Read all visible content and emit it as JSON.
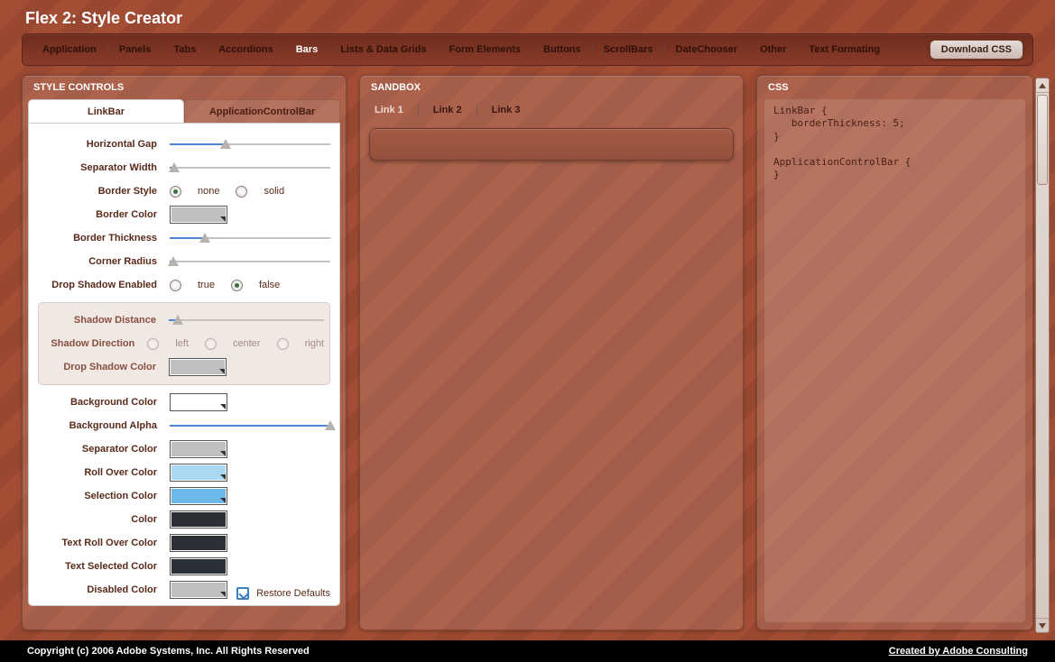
{
  "app_title": "Flex 2: Style Creator",
  "nav": {
    "items": [
      "Application",
      "Panels",
      "Tabs",
      "Accordions",
      "Bars",
      "Lists & Data Grids",
      "Form Elements",
      "Buttons",
      "ScrollBars",
      "DateChooser",
      "Other",
      "Text Formating"
    ],
    "active_index": 4,
    "download_label": "Download CSS"
  },
  "left": {
    "header": "STYLE CONTROLS",
    "subtabs": {
      "active": "LinkBar",
      "inactive": "ApplicationControlBar"
    },
    "rows": {
      "horizontal_gap": "Horizontal Gap",
      "separator_width": "Separator Width",
      "border_style": "Border Style",
      "border_style_opts": [
        "none",
        "solid"
      ],
      "border_color": "Border Color",
      "border_thickness": "Border Thickness",
      "corner_radius": "Corner Radius",
      "drop_shadow_enabled": "Drop Shadow Enabled",
      "shadow_enabled_opts": [
        "true",
        "false"
      ],
      "shadow_distance": "Shadow Distance",
      "shadow_direction": "Shadow Direction",
      "shadow_direction_opts": [
        "left",
        "center",
        "right"
      ],
      "drop_shadow_color": "Drop Shadow Color",
      "background_color": "Background Color",
      "background_alpha": "Background Alpha",
      "separator_color": "Separator Color",
      "roll_over_color": "Roll Over Color",
      "selection_color": "Selection Color",
      "color": "Color",
      "text_roll_over_color": "Text Roll Over Color",
      "text_selected_color": "Text Selected Color",
      "disabled_color": "Disabled Color"
    },
    "swatches": {
      "border_color": "#bfbfbf",
      "drop_shadow_color": "#bfbfbf",
      "background_color": "#ffffff",
      "separator_color": "#bfbfbf",
      "roll_over_color": "#a9d7f4",
      "selection_color": "#6db8ea",
      "color": "#2a3036",
      "text_roll_over_color": "#2a3036",
      "text_selected_color": "#2a3036",
      "disabled_color": "#bfbfbf"
    },
    "sliders": {
      "horizontal_gap_pct": 35,
      "separator_width_pct": 3,
      "border_thickness_pct": 22,
      "corner_radius_pct": 2,
      "shadow_distance_pct": 6,
      "background_alpha_pct": 100
    },
    "border_style_selected": "none",
    "shadow_enabled_selected": "false",
    "restore_label": "Restore Defaults"
  },
  "mid": {
    "header": "SANDBOX",
    "links": [
      "Link 1",
      "Link 2",
      "Link 3"
    ]
  },
  "right": {
    "header": "CSS",
    "code": "LinkBar {\n   borderThickness: 5;\n}\n\nApplicationControlBar {\n}"
  },
  "footer": {
    "copyright": "Copyright (c) 2006 Adobe Systems, Inc. All Rights Reserved",
    "credit": "Created by Adobe Consulting"
  }
}
